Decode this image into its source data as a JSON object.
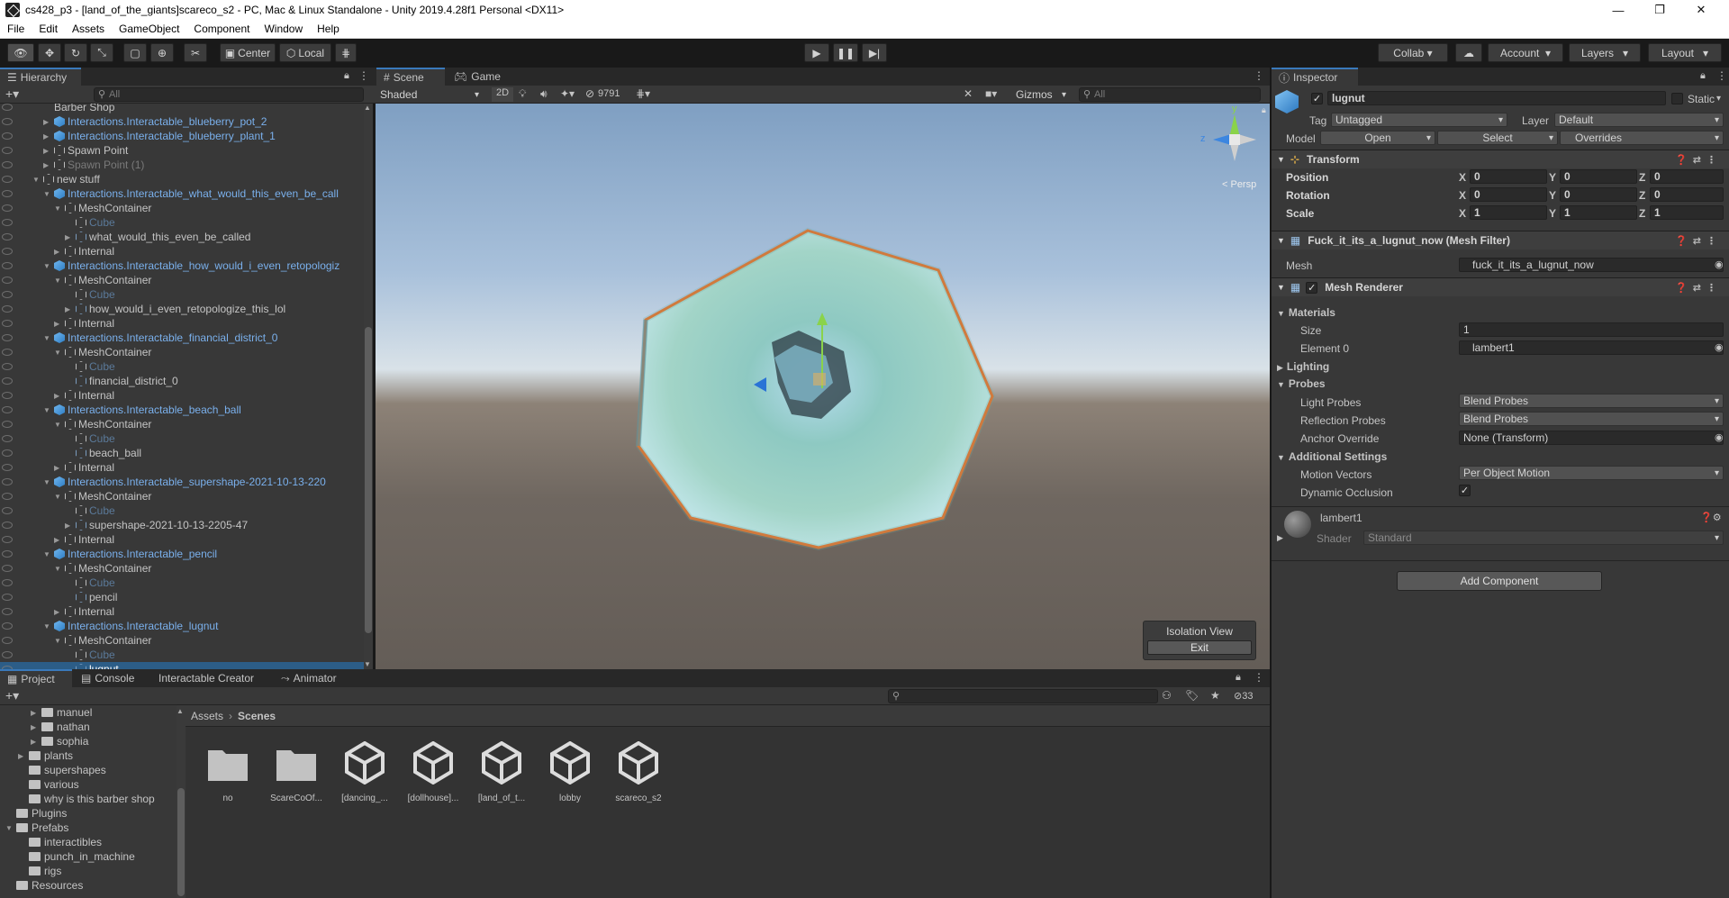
{
  "window": {
    "title": "cs428_p3 - [land_of_the_giants]scareco_s2 - PC, Mac & Linux Standalone - Unity 2019.4.28f1 Personal <DX11>",
    "controls": [
      "—",
      "❐",
      "✕"
    ]
  },
  "menu": [
    "File",
    "Edit",
    "Assets",
    "GameObject",
    "Component",
    "Window",
    "Help"
  ],
  "toolbar": {
    "pivot": "Center",
    "space": "Local",
    "collab": "Collab",
    "account": "Account",
    "layers": "Layers",
    "layout": "Layout"
  },
  "hierarchy": {
    "tab": "Hierarchy",
    "search_placeholder": "All",
    "rows": [
      {
        "label": "Barber Shop",
        "indent": 2,
        "icon": "none",
        "fold": "",
        "style": "normal"
      },
      {
        "label": "Interactions.Interactable_blueberry_pot_2",
        "indent": 2,
        "icon": "blue",
        "fold": "▶",
        "style": "blue"
      },
      {
        "label": "Interactions.Interactable_blueberry_plant_1",
        "indent": 2,
        "icon": "blue",
        "fold": "▶",
        "style": "blue"
      },
      {
        "label": "Spawn Point",
        "indent": 2,
        "icon": "hollow",
        "fold": "▶",
        "style": "normal"
      },
      {
        "label": "Spawn Point (1)",
        "indent": 2,
        "icon": "hollow",
        "fold": "▶",
        "style": "disabled"
      },
      {
        "label": "new stuff",
        "indent": 1,
        "icon": "hollow",
        "fold": "▼",
        "style": "normal"
      },
      {
        "label": "Interactions.Interactable_what_would_this_even_be_call",
        "indent": 2,
        "icon": "blue",
        "fold": "▼",
        "style": "blue"
      },
      {
        "label": "MeshContainer",
        "indent": 3,
        "icon": "hollow",
        "fold": "▼",
        "style": "normal"
      },
      {
        "label": "Cube",
        "indent": 4,
        "icon": "hollow",
        "fold": "",
        "style": "dim"
      },
      {
        "label": "what_would_this_even_be_called",
        "indent": 4,
        "icon": "meshy",
        "fold": "▶",
        "style": "normal"
      },
      {
        "label": "Internal",
        "indent": 3,
        "icon": "hollow",
        "fold": "▶",
        "style": "normal"
      },
      {
        "label": "Interactions.Interactable_how_would_i_even_retopologiz",
        "indent": 2,
        "icon": "blue",
        "fold": "▼",
        "style": "blue"
      },
      {
        "label": "MeshContainer",
        "indent": 3,
        "icon": "hollow",
        "fold": "▼",
        "style": "normal"
      },
      {
        "label": "Cube",
        "indent": 4,
        "icon": "hollow",
        "fold": "",
        "style": "dim"
      },
      {
        "label": "how_would_i_even_retopologize_this_lol",
        "indent": 4,
        "icon": "meshy",
        "fold": "▶",
        "style": "normal"
      },
      {
        "label": "Internal",
        "indent": 3,
        "icon": "hollow",
        "fold": "▶",
        "style": "normal"
      },
      {
        "label": "Interactions.Interactable_financial_district_0",
        "indent": 2,
        "icon": "blue",
        "fold": "▼",
        "style": "blue"
      },
      {
        "label": "MeshContainer",
        "indent": 3,
        "icon": "hollow",
        "fold": "▼",
        "style": "normal"
      },
      {
        "label": "Cube",
        "indent": 4,
        "icon": "hollow",
        "fold": "",
        "style": "dim"
      },
      {
        "label": "financial_district_0",
        "indent": 4,
        "icon": "meshy",
        "fold": "",
        "style": "normal"
      },
      {
        "label": "Internal",
        "indent": 3,
        "icon": "hollow",
        "fold": "▶",
        "style": "normal"
      },
      {
        "label": "Interactions.Interactable_beach_ball",
        "indent": 2,
        "icon": "blue",
        "fold": "▼",
        "style": "blue"
      },
      {
        "label": "MeshContainer",
        "indent": 3,
        "icon": "hollow",
        "fold": "▼",
        "style": "normal"
      },
      {
        "label": "Cube",
        "indent": 4,
        "icon": "hollow",
        "fold": "",
        "style": "dim"
      },
      {
        "label": "beach_ball",
        "indent": 4,
        "icon": "meshy",
        "fold": "",
        "style": "normal"
      },
      {
        "label": "Internal",
        "indent": 3,
        "icon": "hollow",
        "fold": "▶",
        "style": "normal"
      },
      {
        "label": "Interactions.Interactable_supershape-2021-10-13-220",
        "indent": 2,
        "icon": "blue",
        "fold": "▼",
        "style": "blue"
      },
      {
        "label": "MeshContainer",
        "indent": 3,
        "icon": "hollow",
        "fold": "▼",
        "style": "normal"
      },
      {
        "label": "Cube",
        "indent": 4,
        "icon": "hollow",
        "fold": "",
        "style": "dim"
      },
      {
        "label": "supershape-2021-10-13-2205-47",
        "indent": 4,
        "icon": "meshy",
        "fold": "▶",
        "style": "normal"
      },
      {
        "label": "Internal",
        "indent": 3,
        "icon": "hollow",
        "fold": "▶",
        "style": "normal"
      },
      {
        "label": "Interactions.Interactable_pencil",
        "indent": 2,
        "icon": "blue",
        "fold": "▼",
        "style": "blue"
      },
      {
        "label": "MeshContainer",
        "indent": 3,
        "icon": "hollow",
        "fold": "▼",
        "style": "normal"
      },
      {
        "label": "Cube",
        "indent": 4,
        "icon": "hollow",
        "fold": "",
        "style": "dim"
      },
      {
        "label": "pencil",
        "indent": 4,
        "icon": "meshy",
        "fold": "",
        "style": "normal"
      },
      {
        "label": "Internal",
        "indent": 3,
        "icon": "hollow",
        "fold": "▶",
        "style": "normal"
      },
      {
        "label": "Interactions.Interactable_lugnut",
        "indent": 2,
        "icon": "blue",
        "fold": "▼",
        "style": "blue"
      },
      {
        "label": "MeshContainer",
        "indent": 3,
        "icon": "hollow",
        "fold": "▼",
        "style": "normal"
      },
      {
        "label": "Cube",
        "indent": 4,
        "icon": "hollow",
        "fold": "",
        "style": "dim"
      },
      {
        "label": "lugnut",
        "indent": 4,
        "icon": "meshy",
        "fold": "",
        "style": "selected"
      }
    ]
  },
  "scene": {
    "tabs": [
      "Scene",
      "Game"
    ],
    "shading": "Shaded",
    "mode_2d": "2D",
    "hidden_count": "9791",
    "gizmos": "Gizmos",
    "search_placeholder": "All",
    "persp_label": "< Persp",
    "axis_y": "y",
    "axis_z": "z",
    "isolation_title": "Isolation View",
    "isolation_exit": "Exit"
  },
  "inspector": {
    "tab": "Inspector",
    "object_name": "lugnut",
    "static_label": "Static",
    "tag_label": "Tag",
    "tag_value": "Untagged",
    "layer_label": "Layer",
    "layer_value": "Default",
    "model_label": "Model",
    "open_label": "Open",
    "select_label": "Select",
    "overrides_label": "Overrides",
    "transform": {
      "title": "Transform",
      "rows": [
        {
          "label": "Position",
          "x": "0",
          "y": "0",
          "z": "0"
        },
        {
          "label": "Rotation",
          "x": "0",
          "y": "0",
          "z": "0"
        },
        {
          "label": "Scale",
          "x": "1",
          "y": "1",
          "z": "1"
        }
      ],
      "axis": [
        "X",
        "Y",
        "Z"
      ]
    },
    "mesh_filter": {
      "title": "Fuck_it_its_a_lugnut_now (Mesh Filter)",
      "mesh_label": "Mesh",
      "mesh_value": "fuck_it_its_a_lugnut_now"
    },
    "mesh_renderer": {
      "title": "Mesh Renderer",
      "materials_label": "Materials",
      "size_label": "Size",
      "size_value": "1",
      "element_label": "Element 0",
      "element_value": "lambert1",
      "lighting_label": "Lighting",
      "probes_label": "Probes",
      "light_probes_label": "Light Probes",
      "light_probes_value": "Blend Probes",
      "reflection_probes_label": "Reflection Probes",
      "reflection_probes_value": "Blend Probes",
      "anchor_label": "Anchor Override",
      "anchor_value": "None (Transform)",
      "additional_label": "Additional Settings",
      "motion_label": "Motion Vectors",
      "motion_value": "Per Object Motion",
      "occlusion_label": "Dynamic Occlusion"
    },
    "material": {
      "name": "lambert1",
      "shader_label": "Shader",
      "shader_value": "Standard"
    },
    "add_component": "Add Component"
  },
  "project": {
    "tabs": [
      "Project",
      "Console",
      "Interactable Creator",
      "Animator"
    ],
    "hidden_count": "33",
    "tree": [
      {
        "label": "manuel",
        "indent": 3,
        "fold": "▶"
      },
      {
        "label": "nathan",
        "indent": 3,
        "fold": "▶"
      },
      {
        "label": "sophia",
        "indent": 3,
        "fold": "▶"
      },
      {
        "label": "plants",
        "indent": 2,
        "fold": "▶"
      },
      {
        "label": "supershapes",
        "indent": 2,
        "fold": ""
      },
      {
        "label": "various",
        "indent": 2,
        "fold": ""
      },
      {
        "label": "why is this barber shop",
        "indent": 2,
        "fold": ""
      },
      {
        "label": "Plugins",
        "indent": 1,
        "fold": ""
      },
      {
        "label": "Prefabs",
        "indent": 1,
        "fold": "▼"
      },
      {
        "label": "interactibles",
        "indent": 2,
        "fold": ""
      },
      {
        "label": "punch_in_machine",
        "indent": 2,
        "fold": ""
      },
      {
        "label": "rigs",
        "indent": 2,
        "fold": ""
      },
      {
        "label": "Resources",
        "indent": 1,
        "fold": ""
      }
    ],
    "breadcrumb": [
      "Assets",
      "Scenes"
    ],
    "assets": [
      {
        "label": "no",
        "type": "folder"
      },
      {
        "label": "ScareCoOf...",
        "type": "folder"
      },
      {
        "label": "[dancing_...",
        "type": "scene"
      },
      {
        "label": "[dollhouse]...",
        "type": "scene"
      },
      {
        "label": "[land_of_t...",
        "type": "scene"
      },
      {
        "label": "lobby",
        "type": "scene"
      },
      {
        "label": "scareco_s2",
        "type": "scene"
      }
    ]
  },
  "colors": {
    "selection": "#2c5d87",
    "accent_blue": "#7ab0ec",
    "outline_orange": "#f26b1d",
    "panel": "#383838",
    "dark": "#282828"
  }
}
